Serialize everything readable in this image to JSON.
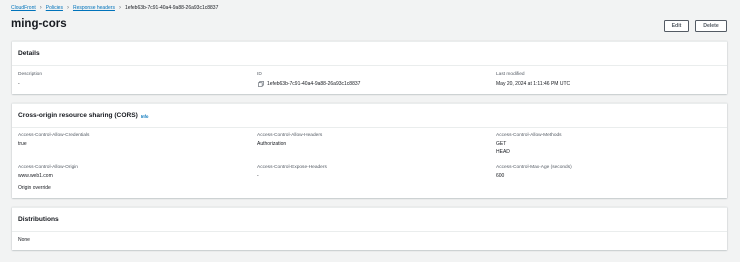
{
  "breadcrumb": {
    "items": [
      "CloudFront",
      "Policies",
      "Response headers"
    ],
    "current": "1efeb63b-7c91-40a4-9a88-26a93c1c8837"
  },
  "page": {
    "title": "ming-cors",
    "edit_label": "Edit",
    "delete_label": "Delete"
  },
  "details": {
    "title": "Details",
    "description_label": "Description",
    "description_value": "-",
    "id_label": "ID",
    "id_value": "1efeb63b-7c91-40a4-9a88-26a93c1c8837",
    "last_modified_label": "Last modified",
    "last_modified_value": "May 20, 2024 at 1:11:46 PM UTC"
  },
  "cors": {
    "title": "Cross-origin resource sharing (CORS)",
    "info_label": "Info",
    "allow_credentials_label": "Access-Control-Allow-Credentials",
    "allow_credentials_value": "true",
    "allow_headers_label": "Access-Control-Allow-Headers",
    "allow_headers_value": "Authorization",
    "allow_methods_label": "Access-Control-Allow-Methods",
    "allow_methods_values": [
      "GET",
      "HEAD"
    ],
    "allow_origin_label": "Access-Control-Allow-Origin",
    "allow_origin_value": "www.web1.com",
    "origin_override_label": "Origin override",
    "expose_headers_label": "Access-Control-Expose-Headers",
    "expose_headers_value": "-",
    "max_age_label": "Access-Control-Max-Age (seconds)",
    "max_age_value": "600"
  },
  "distributions": {
    "title": "Distributions",
    "value": "None"
  },
  "icons": {
    "breadcrumb_separator": "chevron-right-icon",
    "copy": "copy-icon"
  },
  "colors": {
    "link": "#0073bb",
    "background": "#f2f3f3",
    "text": "#16191f",
    "label": "#545b64"
  }
}
